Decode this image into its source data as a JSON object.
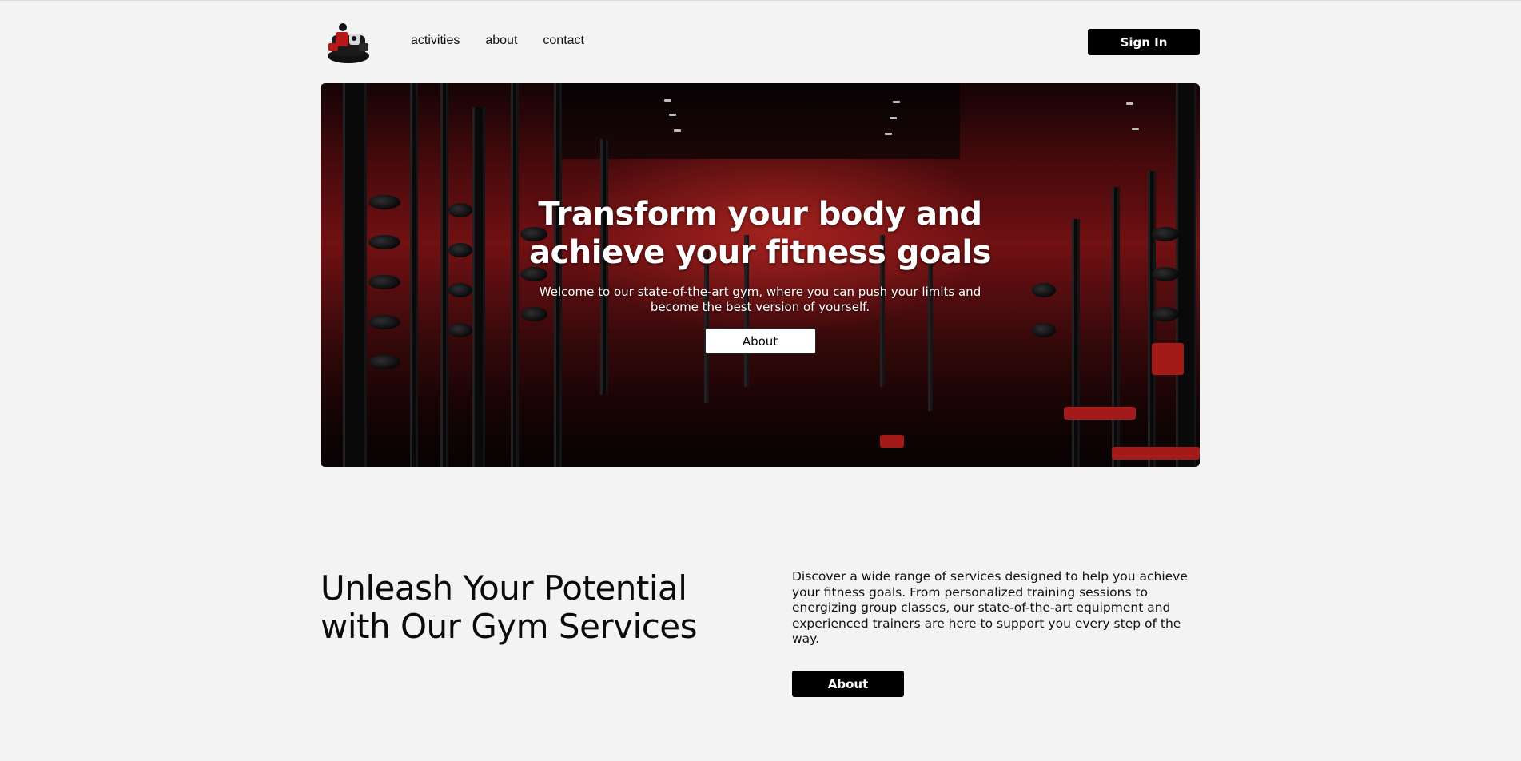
{
  "nav": {
    "logo_icon": "gym-mascot-logo",
    "links": [
      "activities",
      "about",
      "contact"
    ],
    "signin_label": "Sign In"
  },
  "hero": {
    "title": "Transform your body and achieve your fitness goals",
    "subtitle": "Welcome to our state-of-the-art gym, where you can push your limits and become the best version of yourself.",
    "button_label": "About",
    "accent_color": "#c7201e"
  },
  "services": {
    "title": "Unleash Your Potential with Our Gym Services",
    "text": "Discover a wide range of services designed to help you achieve your fitness goals. From personalized training sessions to energizing group classes, our state-of-the-art equipment and experienced trainers are here to support you every step of the way.",
    "button_label": "About"
  }
}
